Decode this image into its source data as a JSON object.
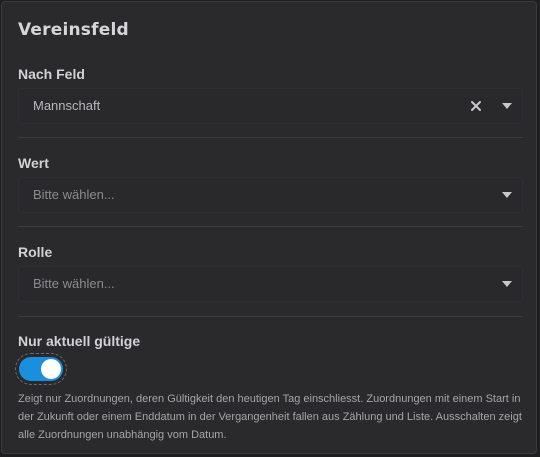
{
  "panel": {
    "title": "Vereinsfeld"
  },
  "fields": {
    "nach_feld": {
      "label": "Nach Feld",
      "value": "Mannschaft"
    },
    "wert": {
      "label": "Wert",
      "placeholder": "Bitte wählen..."
    },
    "rolle": {
      "label": "Rolle",
      "placeholder": "Bitte wählen..."
    }
  },
  "toggle": {
    "label": "Nur aktuell gültige",
    "state": "on",
    "help": "Zeigt nur Zuordnungen, deren Gültigkeit den heutigen Tag einschliesst. Zuordnungen mit einem Start in der Zukunft oder einem Enddatum in der Vergangenheit fallen aus Zählung und Liste. Ausschalten zeigt alle Zuordnungen unabhängig vom Datum."
  },
  "colors": {
    "panel_bg": "#2a2a2d",
    "toggle_on": "#1a8fe0"
  },
  "icons": {
    "clear": "close-icon",
    "dropdown": "caret-down-icon"
  }
}
